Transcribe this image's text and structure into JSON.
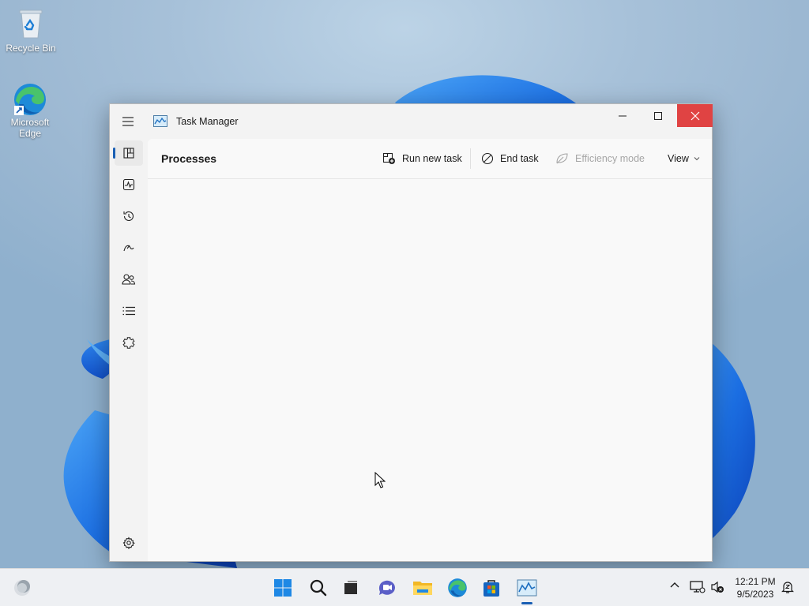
{
  "desktop": {
    "icons": [
      {
        "label": "Recycle Bin",
        "icon": "recycle-bin-icon"
      },
      {
        "label": "Microsoft Edge",
        "icon": "edge-icon"
      }
    ]
  },
  "window": {
    "title": "Task Manager",
    "buttons": {
      "minimize": "minimize-icon",
      "maximize": "maximize-icon",
      "close": "close-icon"
    },
    "close_color": "#e04343",
    "nav": [
      {
        "name": "processes",
        "icon": "processes-icon",
        "active": true
      },
      {
        "name": "performance",
        "icon": "performance-icon"
      },
      {
        "name": "app-history",
        "icon": "history-icon"
      },
      {
        "name": "startup-apps",
        "icon": "startup-icon"
      },
      {
        "name": "users",
        "icon": "users-icon"
      },
      {
        "name": "details",
        "icon": "details-icon"
      },
      {
        "name": "services",
        "icon": "services-icon"
      },
      {
        "name": "settings",
        "icon": "gear-icon"
      }
    ],
    "page_title": "Processes",
    "commands": {
      "run_new_task": "Run new task",
      "end_task": "End task",
      "efficiency_mode": "Efficiency mode",
      "view": "View"
    },
    "accent": "#1a5fb4"
  },
  "taskbar": {
    "apps": [
      "start-icon",
      "search-icon",
      "task-view-icon",
      "chat-icon",
      "file-explorer-icon",
      "edge-icon",
      "store-icon",
      "task-manager-icon"
    ],
    "tray": [
      "chevron-up-icon",
      "network-icon",
      "volume-mute-icon",
      "notification-icon"
    ],
    "time": "12:21 PM",
    "date": "9/5/2023"
  }
}
